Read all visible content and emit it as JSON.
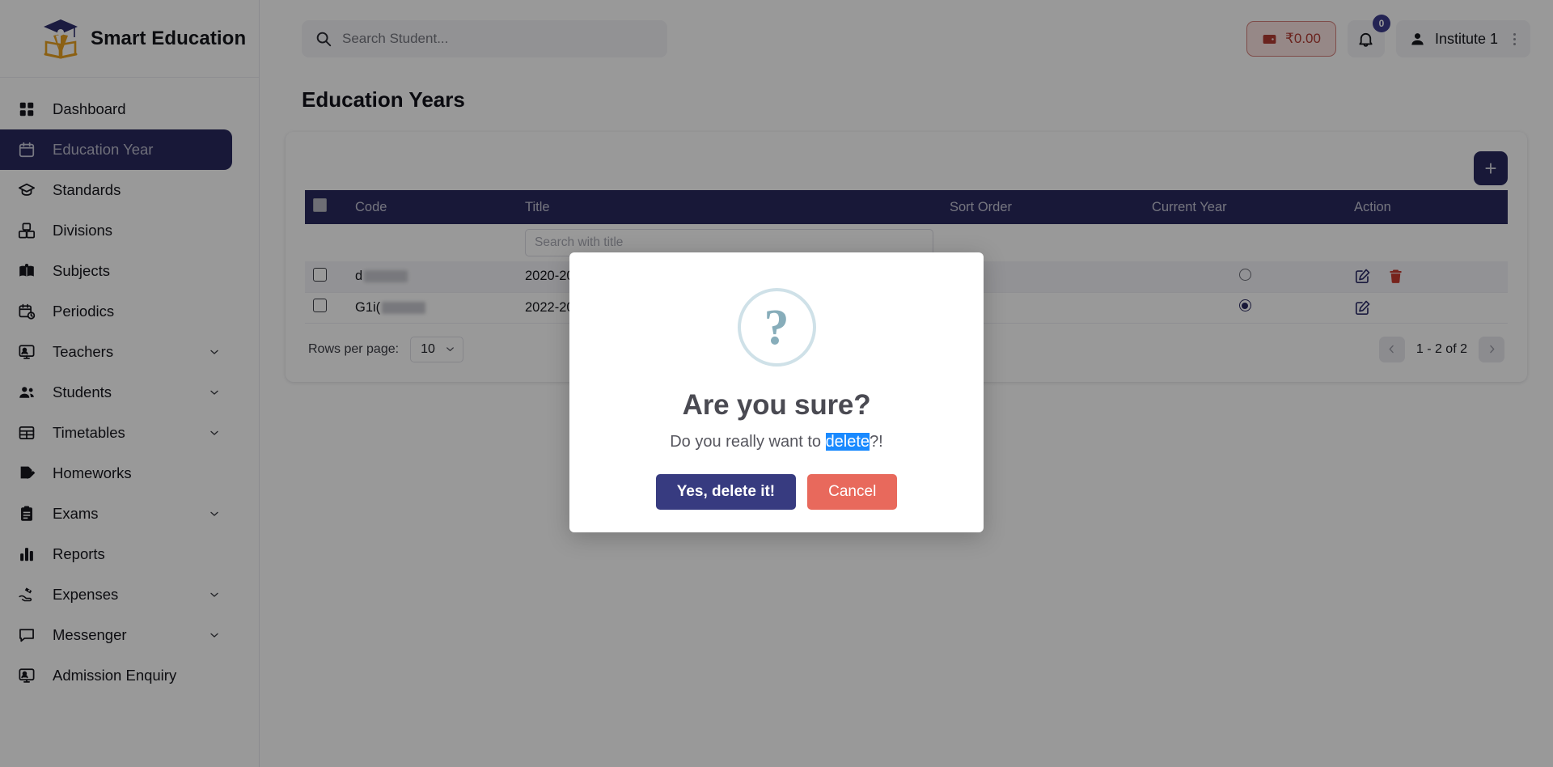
{
  "brand": {
    "name": "Smart Education"
  },
  "sidebar": {
    "items": [
      {
        "label": "Dashboard",
        "icon": "grid-icon",
        "expandable": false,
        "active": false
      },
      {
        "label": "Education Year",
        "icon": "calendar-icon",
        "expandable": false,
        "active": true
      },
      {
        "label": "Standards",
        "icon": "graduation-cap-icon",
        "expandable": false,
        "active": false
      },
      {
        "label": "Divisions",
        "icon": "blocks-icon",
        "expandable": false,
        "active": false
      },
      {
        "label": "Subjects",
        "icon": "book-icon",
        "expandable": false,
        "active": false
      },
      {
        "label": "Periodics",
        "icon": "calendar-clock-icon",
        "expandable": false,
        "active": false
      },
      {
        "label": "Teachers",
        "icon": "presentation-icon",
        "expandable": true,
        "active": false
      },
      {
        "label": "Students",
        "icon": "users-icon",
        "expandable": true,
        "active": false
      },
      {
        "label": "Timetables",
        "icon": "table-icon",
        "expandable": true,
        "active": false
      },
      {
        "label": "Homeworks",
        "icon": "note-edit-icon",
        "expandable": false,
        "active": false
      },
      {
        "label": "Exams",
        "icon": "clipboard-icon",
        "expandable": true,
        "active": false
      },
      {
        "label": "Reports",
        "icon": "bar-chart-icon",
        "expandable": false,
        "active": false
      },
      {
        "label": "Expenses",
        "icon": "hand-money-icon",
        "expandable": true,
        "active": false
      },
      {
        "label": "Messenger",
        "icon": "chat-bubble-icon",
        "expandable": true,
        "active": false
      },
      {
        "label": "Admission Enquiry",
        "icon": "presentation-icon",
        "expandable": false,
        "active": false
      }
    ]
  },
  "topbar": {
    "search_placeholder": "Search Student...",
    "search_value": "",
    "search_icon": "search-icon",
    "wallet_icon": "wallet-icon",
    "wallet_amount": "₹0.00",
    "bell_icon": "bell-icon",
    "notification_count": "0",
    "user_icon": "user-icon",
    "user_name": "Institute 1",
    "kebab_icon": "kebab-menu-icon"
  },
  "page": {
    "title": "Education Years",
    "add_button_label": "+"
  },
  "table": {
    "columns": [
      "Code",
      "Title",
      "Sort Order",
      "Current Year",
      "Action"
    ],
    "title_filter_placeholder": "Search with title",
    "title_filter_value": "",
    "rows": [
      {
        "code": "d",
        "code_redacted": true,
        "title": "2020-20",
        "sort_order": "",
        "current_year": false,
        "has_edit": true,
        "has_delete": true
      },
      {
        "code": "G1i(",
        "code_redacted": true,
        "title": "2022-20",
        "sort_order": "",
        "current_year": true,
        "has_edit": true,
        "has_delete": false
      }
    ]
  },
  "footer": {
    "rows_per_page_label": "Rows per page:",
    "rows_per_page_value": "10",
    "range_label": "1 - 2 of 2",
    "prev_icon": "chevron-left-icon",
    "next_icon": "chevron-right-icon"
  },
  "modal": {
    "icon": "question-mark-icon",
    "title": "Are you sure?",
    "text_before": "Do you really want to ",
    "text_selected": "delete",
    "text_after": "?!",
    "confirm_label": "Yes, delete it!",
    "cancel_label": "Cancel"
  },
  "colors": {
    "brand_navy": "#28285e",
    "accent_red": "#e8695c",
    "confirm_navy": "#373b80",
    "selection_blue": "#1a8aff",
    "delete_icon_red": "#c63b30"
  }
}
